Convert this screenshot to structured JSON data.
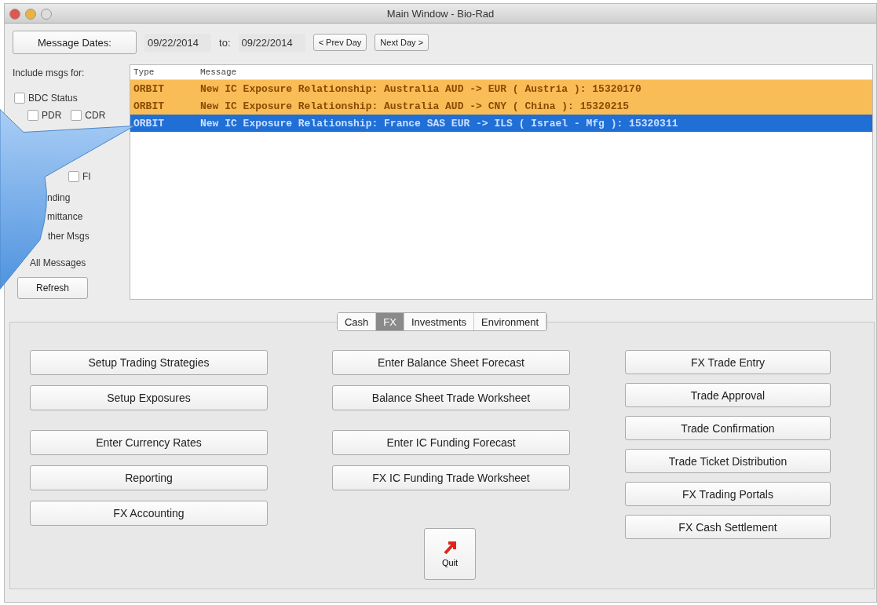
{
  "window": {
    "title": "Main Window - Bio-Rad"
  },
  "dates": {
    "label": "Message Dates:",
    "from": "09/22/2014",
    "to_label": "to:",
    "to": "09/22/2014",
    "buttons": [
      "< Prev Day",
      "Next Day >"
    ]
  },
  "filters": {
    "title": "Include msgs for:",
    "items": [
      {
        "label": "BDC Status",
        "checked": false,
        "children": [
          {
            "label": "PDR",
            "checked": false
          },
          {
            "label": "CDR",
            "checked": false
          }
        ]
      },
      {
        "label": "FI",
        "checked": false
      },
      {
        "label": "nding"
      },
      {
        "label": "mittance"
      },
      {
        "label": "ther Msgs"
      },
      {
        "label": "All Messages"
      }
    ],
    "refresh": "Refresh"
  },
  "messages": {
    "columns": [
      "Type",
      "Message"
    ],
    "rows": [
      {
        "type": "ORBIT",
        "message": "New IC Exposure Relationship: Australia AUD -> EUR ( Austria ): 15320170",
        "highlighted": true,
        "selected": false
      },
      {
        "type": "ORBIT",
        "message": "New IC Exposure Relationship: Australia AUD -> CNY ( China ): 15320215",
        "highlighted": true,
        "selected": false
      },
      {
        "type": "ORBIT",
        "message": "New IC Exposure Relationship: France SAS EUR -> ILS ( Israel - Mfg ): 15320311",
        "highlighted": false,
        "selected": true
      }
    ]
  },
  "tabs": [
    {
      "label": "Cash",
      "selected": false
    },
    {
      "label": "FX",
      "selected": true
    },
    {
      "label": "Investments",
      "selected": false
    },
    {
      "label": "Environment",
      "selected": false
    }
  ],
  "columns": [
    [
      "Setup Trading Strategies",
      "Setup Exposures",
      "Enter Currency Rates",
      "Reporting",
      "FX Accounting"
    ],
    [
      "Enter Balance Sheet Forecast",
      "Balance Sheet Trade Worksheet",
      "Enter IC Funding Forecast",
      "FX IC Funding Trade Worksheet"
    ],
    [
      "FX Trade Entry",
      "Trade Approval",
      "Trade Confirmation",
      "Trade Ticket Distribution",
      "FX Trading Portals",
      "FX Cash Settlement"
    ]
  ],
  "quit": "Quit"
}
